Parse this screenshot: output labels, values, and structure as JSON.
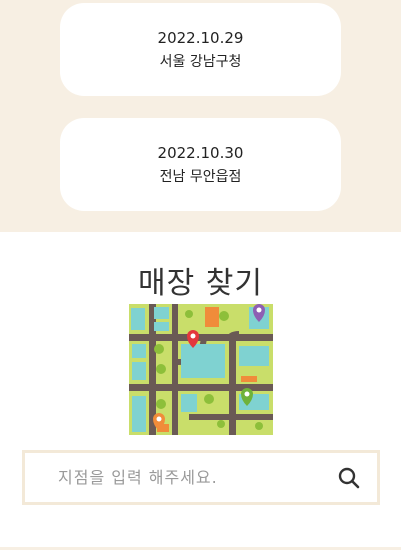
{
  "events": [
    {
      "date": "2022.10.29",
      "store": "서울 강남구청"
    },
    {
      "date": "2022.10.30",
      "store": "전남 무안읍점"
    }
  ],
  "store_finder": {
    "title": "매장 찾기",
    "search_placeholder": "지점을 입력 해주세요.",
    "search_icon": "search-icon"
  },
  "colors": {
    "section_bg": "#f7efe3",
    "card_bg": "#ffffff",
    "search_border": "#f3e9d8"
  }
}
